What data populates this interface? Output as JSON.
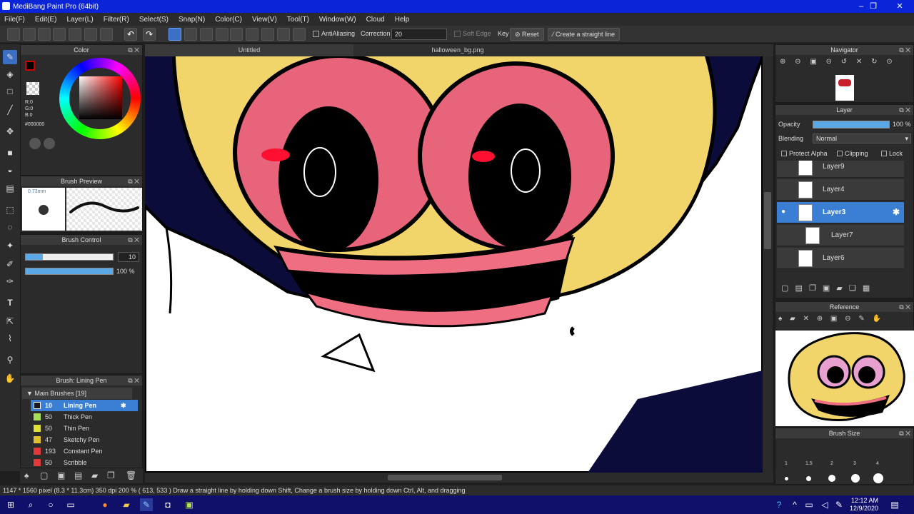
{
  "window": {
    "title": "MediBang Paint Pro (64bit)",
    "minimize": "–",
    "maximize": "❐",
    "close": "✕"
  },
  "menu": [
    "File(F)",
    "Edit(E)",
    "Layer(L)",
    "Filter(R)",
    "Select(S)",
    "Snap(N)",
    "Color(C)",
    "View(V)",
    "Tool(T)",
    "Window(W)",
    "Cloud",
    "Help"
  ],
  "toolbar": {
    "antialiasing": "AntiAliasing",
    "correction_label": "Correction",
    "correction_value": "20",
    "soft_edge": "Soft Edge",
    "key": "Key",
    "reset": "Reset",
    "straight_line": "Create a straight line"
  },
  "tabs": [
    "Untitled",
    "halloween_bg.png"
  ],
  "color_panel": {
    "title": "Color",
    "r": "R:0",
    "g": "G:0",
    "b": "B:0",
    "hex": "#000000"
  },
  "brush_preview": {
    "title": "Brush Preview",
    "size": "0.73mm"
  },
  "brush_control": {
    "title": "Brush Control",
    "size_value": "10",
    "opacity_value": "100 %",
    "size_fraction": 0.2,
    "opacity_fraction": 1.0
  },
  "brush_list": {
    "title": "Brush: Lining Pen",
    "group": "Main Brushes [19]",
    "items": [
      {
        "size": "10",
        "name": "Lining Pen",
        "color": "#1a1a1a"
      },
      {
        "size": "50",
        "name": "Thick Pen",
        "color": "#a6e05a"
      },
      {
        "size": "50",
        "name": "Thin Pen",
        "color": "#e0e03a"
      },
      {
        "size": "47",
        "name": "Sketchy Pen",
        "color": "#e0c030"
      },
      {
        "size": "193",
        "name": "Constant Pen",
        "color": "#e03a3a"
      },
      {
        "size": "50",
        "name": "Scribble",
        "color": "#e03a3a"
      }
    ]
  },
  "navigator": {
    "title": "Navigator"
  },
  "layer_panel": {
    "title": "Layer",
    "opacity_label": "Opacity",
    "opacity_value": "100 %",
    "opacity_fraction": 1.0,
    "blending_label": "Blending",
    "blending_value": "Normal",
    "protect_alpha": "Protect Alpha",
    "clipping": "Clipping",
    "lock": "Lock",
    "layers": [
      "Layer9",
      "Layer4",
      "Layer3",
      "Layer7",
      "Layer6"
    ]
  },
  "reference": {
    "title": "Reference"
  },
  "brush_size": {
    "title": "Brush Size",
    "labels": [
      "1",
      "1.5",
      "2",
      "3",
      "4"
    ]
  },
  "status": {
    "text": "1147 * 1560 pixel   (8.3 * 11.3cm)   350 dpi   200 %   ( 613, 533 )   Draw a straight line by holding down Shift, Change a brush size by holding down Ctrl, Alt, and dragging"
  },
  "taskbar": {
    "time": "12:12 AM",
    "date": "12/9/2020"
  },
  "colors": {
    "accent": "#3a7fd4",
    "title_bar": "#0a24d8",
    "canvas_bg": "#0c0c3a",
    "skin": "#f2d56a",
    "eye": "#e8647a",
    "teeth": "#f06e82"
  }
}
